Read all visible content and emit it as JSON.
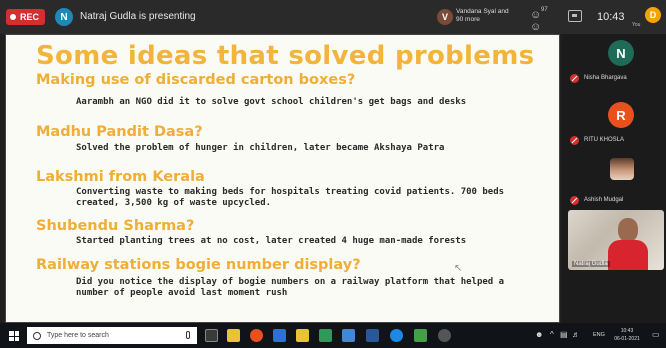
{
  "topbar": {
    "rec_label": "REC",
    "presenter_initial": "N",
    "presenter_text": "Natraj Gudla is presenting",
    "participant_initial": "V",
    "participant_text": "Vandana Syal and 90 more",
    "people_count": "97",
    "time": "10:43",
    "you_initial": "D",
    "you_label": "You"
  },
  "slide": {
    "title": "Some ideas that solved problems",
    "ideas": [
      {
        "heading": "Making use of discarded carton boxes?",
        "lines": [
          "Aarambh an NGO did it to solve govt school children's get bags and desks"
        ]
      },
      {
        "heading": "Madhu Pandit Dasa?",
        "lines": [
          "Solved the problem of hunger in children, later became Akshaya Patra"
        ]
      },
      {
        "heading": "Lakshmi from Kerala",
        "lines": [
          "Converting waste to making beds for hospitals treating covid patients. 700 beds",
          "created, 3,500 kg of waste upcycled."
        ]
      },
      {
        "heading": "Shubendu Sharma?",
        "lines": [
          "Started planting trees at no cost, later created 4 huge man-made forests"
        ]
      },
      {
        "heading": "Railway stations bogie number display?",
        "lines": [
          "Did you notice the display of bogie numbers on a railway platform that helped a",
          "number of people avoid last moment rush"
        ]
      }
    ]
  },
  "participants": [
    {
      "initial": "N",
      "name": "Nisha Bhargava",
      "color": "#1e6b57"
    },
    {
      "initial": "R",
      "name": "RITU KHOSLA",
      "color": "#e8501e"
    },
    {
      "initial": "",
      "name": "Ashish Mudgal",
      "color": ""
    },
    {
      "initial": "",
      "name": "Natraj Gudla",
      "color": ""
    }
  ],
  "taskbar": {
    "search_placeholder": "Type here to search",
    "lang": "ENG",
    "time": "10:43",
    "date": "06-01-2021"
  }
}
